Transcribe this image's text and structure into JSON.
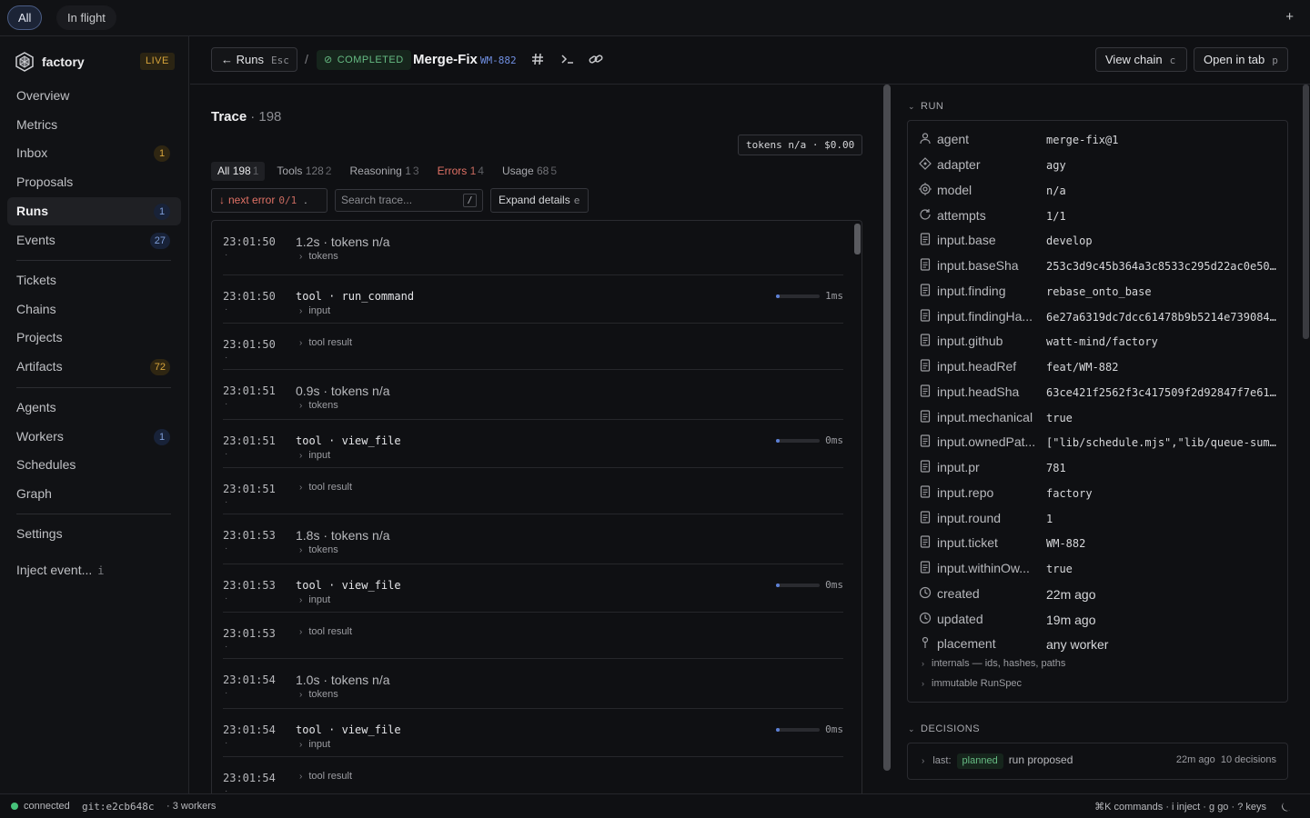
{
  "topbar": {
    "filters": [
      "All",
      "In flight"
    ],
    "plus": "+"
  },
  "sidebar": {
    "brand": "factory",
    "live": "LIVE",
    "items": [
      {
        "label": "Overview"
      },
      {
        "label": "Metrics"
      },
      {
        "label": "Inbox",
        "badge": "1"
      },
      {
        "label": "Proposals"
      },
      {
        "label": "Runs",
        "badge": "1"
      },
      {
        "label": "Events",
        "badge": "27"
      },
      {
        "label": "Tickets"
      },
      {
        "label": "Chains"
      },
      {
        "label": "Projects"
      },
      {
        "label": "Artifacts",
        "badge": "72"
      },
      {
        "label": "Agents"
      },
      {
        "label": "Workers",
        "badge": "1"
      },
      {
        "label": "Schedules"
      },
      {
        "label": "Graph"
      },
      {
        "label": "Settings"
      },
      {
        "label": "Inject event...",
        "key": "i"
      }
    ]
  },
  "header": {
    "back_label": "Runs",
    "back_key": "Esc",
    "separator": "/",
    "status": "COMPLETED",
    "title": "Merge-Fix",
    "ticket": "WM-882",
    "view_chain": "View chain",
    "view_chain_key": "c",
    "open_tab": "Open in tab",
    "open_tab_key": "p"
  },
  "trace": {
    "title": "Trace",
    "count": "· 198",
    "tokens": "tokens n/a · $0.00",
    "tabs": [
      {
        "label": "All",
        "n": "198",
        "n2": "1"
      },
      {
        "label": "Tools",
        "n": "128",
        "n2": "2"
      },
      {
        "label": "Reasoning",
        "n": "1",
        "n2": "3"
      },
      {
        "label": "Errors",
        "n": "1",
        "n2": "4"
      },
      {
        "label": "Usage",
        "n": "68",
        "n2": "5"
      }
    ],
    "next_error": "next error",
    "next_error_count": "0/1",
    "next_error_key": ".",
    "search_placeholder": "Search trace...",
    "search_key": "/",
    "expand": "Expand details",
    "expand_key": "e",
    "rows": [
      {
        "ts": "23:01:50",
        "main": "1.2s · tokens n/a",
        "sub": "tokens"
      },
      {
        "ts": "23:01:50",
        "main": "tool · run_command",
        "sub": "input",
        "dur": "1ms",
        "progress": 0.08
      },
      {
        "ts": "23:01:50",
        "sub": "tool result"
      },
      {
        "ts": "23:01:51",
        "main": "0.9s · tokens n/a",
        "sub": "tokens"
      },
      {
        "ts": "23:01:51",
        "main": "tool · view_file",
        "sub": "input",
        "dur": "0ms",
        "progress": 0.08
      },
      {
        "ts": "23:01:51",
        "sub": "tool result"
      },
      {
        "ts": "23:01:53",
        "main": "1.8s · tokens n/a",
        "sub": "tokens"
      },
      {
        "ts": "23:01:53",
        "main": "tool · view_file",
        "sub": "input",
        "dur": "0ms",
        "progress": 0.08
      },
      {
        "ts": "23:01:53",
        "sub": "tool result"
      },
      {
        "ts": "23:01:54",
        "main": "1.0s · tokens n/a",
        "sub": "tokens"
      },
      {
        "ts": "23:01:54",
        "main": "tool · view_file",
        "sub": "input",
        "dur": "0ms",
        "progress": 0.08
      },
      {
        "ts": "23:01:54",
        "sub": "tool result"
      }
    ]
  },
  "run": {
    "section": "RUN",
    "fields": [
      {
        "key": "agent",
        "value": "merge-fix@1",
        "icon": "person-icon"
      },
      {
        "key": "adapter",
        "value": "agy",
        "icon": "diamond-icon"
      },
      {
        "key": "model",
        "value": "n/a",
        "icon": "target-icon"
      },
      {
        "key": "attempts",
        "value": "1/1",
        "icon": "refresh-icon"
      },
      {
        "key": "input.base",
        "value": "develop",
        "icon": "doc-icon"
      },
      {
        "key": "input.baseSha",
        "value": "253c3d9c45b364a3c8533c295d22ac0e50...",
        "icon": "doc-icon"
      },
      {
        "key": "input.finding",
        "value": "rebase_onto_base",
        "icon": "doc-icon"
      },
      {
        "key": "input.findingHa...",
        "value": "6e27a6319dc7dcc61478b9b5214e739084...",
        "icon": "doc-icon"
      },
      {
        "key": "input.github",
        "value": "watt-mind/factory",
        "icon": "doc-icon"
      },
      {
        "key": "input.headRef",
        "value": "feat/WM-882",
        "icon": "doc-icon"
      },
      {
        "key": "input.headSha",
        "value": "63ce421f2562f3c417509f2d92847f7e61...",
        "icon": "doc-icon"
      },
      {
        "key": "input.mechanical",
        "value": "true",
        "icon": "doc-icon"
      },
      {
        "key": "input.ownedPat...",
        "value": "[\"lib/schedule.mjs\",\"lib/queue-sum...",
        "icon": "doc-icon"
      },
      {
        "key": "input.pr",
        "value": "781",
        "icon": "doc-icon"
      },
      {
        "key": "input.repo",
        "value": "factory",
        "icon": "doc-icon"
      },
      {
        "key": "input.round",
        "value": "1",
        "icon": "doc-icon"
      },
      {
        "key": "input.ticket",
        "value": "WM-882",
        "icon": "doc-icon"
      },
      {
        "key": "input.withinOw...",
        "value": "true",
        "icon": "doc-icon"
      },
      {
        "key": "created",
        "value": "22m ago",
        "icon": "clock-icon"
      },
      {
        "key": "updated",
        "value": "19m ago",
        "icon": "clock-icon"
      },
      {
        "key": "placement",
        "value": "any worker",
        "icon": "pin-icon"
      }
    ],
    "internals": "internals — ids, hashes, paths",
    "runspec": "immutable RunSpec"
  },
  "decisions": {
    "section": "DECISIONS",
    "last_label": "last:",
    "last_tag": "planned",
    "text": "run proposed",
    "time": "22m ago",
    "count": "10 decisions"
  },
  "statusbar": {
    "connected": "connected",
    "git": "git:e2cb648c",
    "workers": "· 3 workers",
    "hints": "⌘K commands · i inject · g go · ? keys"
  },
  "colors": {
    "accent": "#5d80d6",
    "success": "#66bb83",
    "warning": "#d6a33a",
    "error": "#e07165"
  }
}
